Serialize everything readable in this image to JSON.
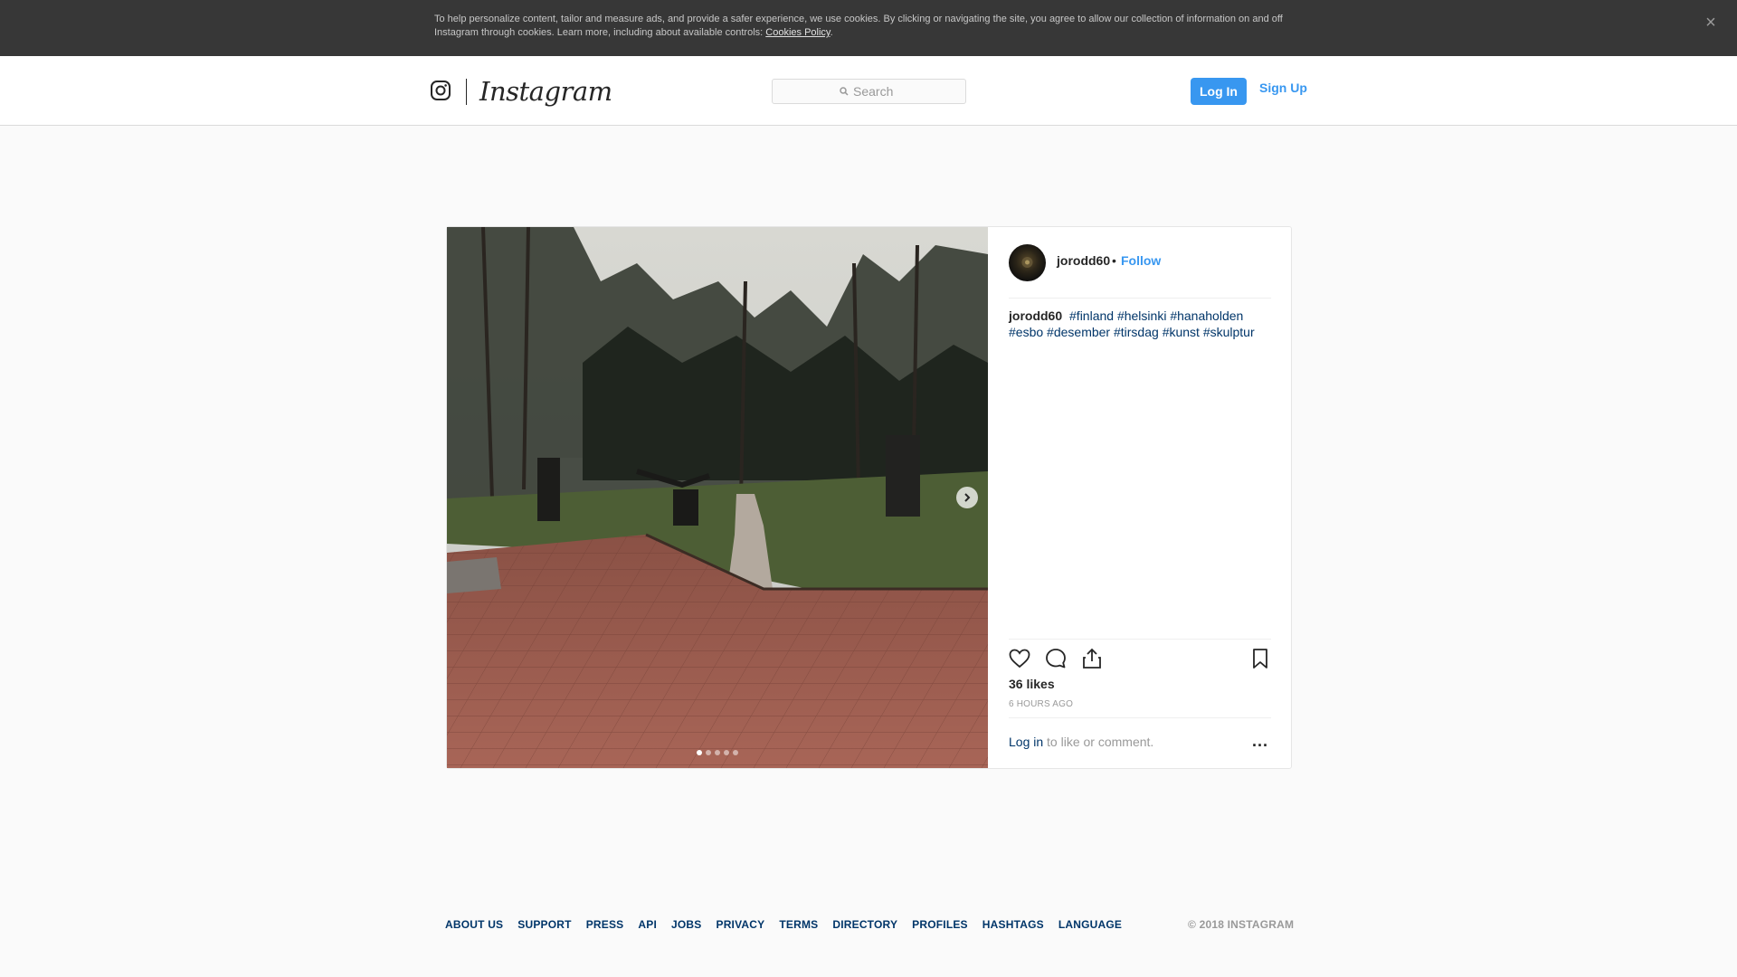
{
  "cookie_banner": {
    "text": "To help personalize content, tailor and measure ads, and provide a safer experience, we use cookies. By clicking or navigating the site, you agree to allow our collection of information on and off Instagram through cookies. Learn more, including about available controls: ",
    "link_label": "Cookies Policy",
    "after_link": ".",
    "close_label": "×"
  },
  "header": {
    "logo_icon": "camera-icon",
    "wordmark": "Instagram",
    "search_placeholder": "Search",
    "login_label": "Log In",
    "signup_label": "Sign Up"
  },
  "post": {
    "username": "jorodd60",
    "bullet": "•",
    "follow_label": "Follow",
    "caption_user": "jorodd60",
    "hashtags": [
      "#finland",
      "#helsinki",
      "#hanaholden",
      "#esbo",
      "#desember",
      "#tirsdag",
      "#kunst",
      "#skulptur"
    ],
    "likes": "36 likes",
    "time_ago": "6 HOURS AGO",
    "login_link": "Log in",
    "login_suffix": " to like or comment.",
    "more_label": "...",
    "carousel": {
      "count": 5,
      "active_index": 0
    },
    "icons": [
      "heart-icon",
      "comment-icon",
      "share-icon",
      "bookmark-icon",
      "chevron-right-icon"
    ]
  },
  "footer": {
    "links": [
      "ABOUT US",
      "SUPPORT",
      "PRESS",
      "API",
      "JOBS",
      "PRIVACY",
      "TERMS",
      "DIRECTORY",
      "PROFILES",
      "HASHTAGS",
      "LANGUAGE"
    ],
    "copyright": "© 2018 INSTAGRAM"
  },
  "colors": {
    "accent": "#3897f0",
    "link": "#003569",
    "banner_bg": "#373737",
    "page_bg": "#fafafa"
  }
}
